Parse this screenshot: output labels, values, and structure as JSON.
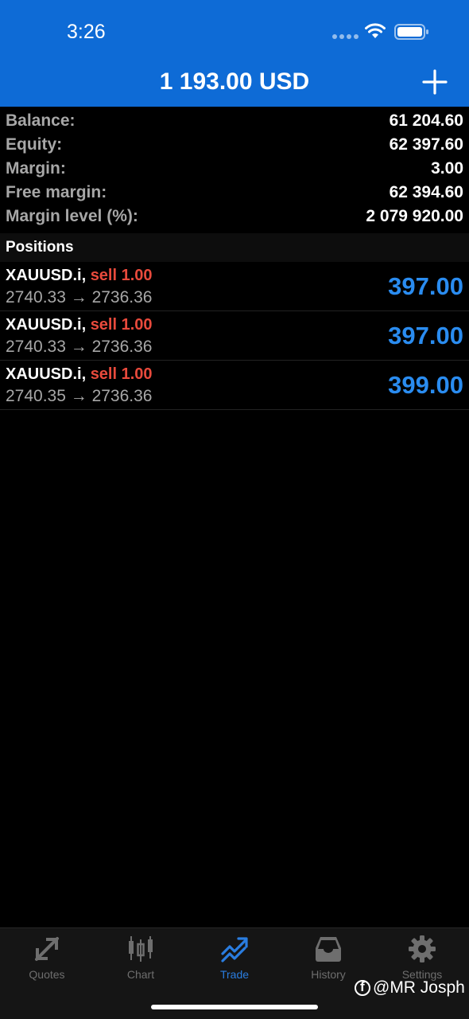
{
  "status_bar": {
    "time": "3:26"
  },
  "header": {
    "title": "1 193.00 USD",
    "add_icon": "plus-icon"
  },
  "summary": [
    {
      "label": "Balance:",
      "value": "61 204.60"
    },
    {
      "label": "Equity:",
      "value": "62 397.60"
    },
    {
      "label": "Margin:",
      "value": "3.00"
    },
    {
      "label": "Free margin:",
      "value": "62 394.60"
    },
    {
      "label": "Margin level (%):",
      "value": "2 079 920.00"
    }
  ],
  "positions_header": "Positions",
  "positions": [
    {
      "symbol": "XAUUSD.i,",
      "side": "sell 1.00",
      "prices": "2740.33 → 2736.36",
      "profit": "397.00"
    },
    {
      "symbol": "XAUUSD.i,",
      "side": "sell 1.00",
      "prices": "2740.33 → 2736.36",
      "profit": "397.00"
    },
    {
      "symbol": "XAUUSD.i,",
      "side": "sell 1.00",
      "prices": "2740.35 → 2736.36",
      "profit": "399.00"
    }
  ],
  "tabs": [
    {
      "label": "Quotes",
      "icon": "quotes-icon"
    },
    {
      "label": "Chart",
      "icon": "chart-icon"
    },
    {
      "label": "Trade",
      "icon": "trade-icon",
      "active": true
    },
    {
      "label": "History",
      "icon": "history-icon"
    },
    {
      "label": "Settings",
      "icon": "settings-icon"
    }
  ],
  "watermark": "@MR Josph",
  "colors": {
    "header_bg": "#0e6bd6",
    "profit": "#2a8cf0",
    "sell": "#e84a3c",
    "active_tab": "#2a7de0"
  }
}
